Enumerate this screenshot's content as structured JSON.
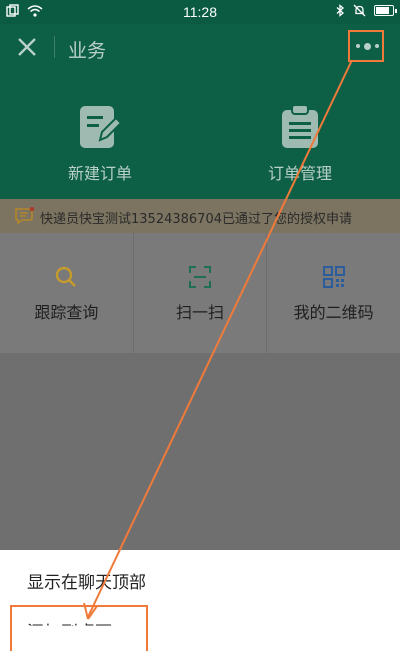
{
  "status_bar": {
    "time": "11:28",
    "battery_level": 0.85
  },
  "header": {
    "title": "业务"
  },
  "quick_actions": [
    {
      "label": "新建订单",
      "icon": "edit-document-icon"
    },
    {
      "label": "订单管理",
      "icon": "clipboard-icon"
    }
  ],
  "notice": {
    "text": "快递员快宝测试13524386704已通过了您的授权申请"
  },
  "grid": [
    {
      "label": "跟踪查询",
      "icon": "search-icon"
    },
    {
      "label": "扫一扫",
      "icon": "scan-icon"
    },
    {
      "label": "我的二维码",
      "icon": "qr-code-icon"
    }
  ],
  "sheet": {
    "items": [
      {
        "label": "显示在聊天顶部"
      },
      {
        "label": "添加到桌面"
      }
    ]
  },
  "colors": {
    "header": "#0d5f46",
    "annotation": "#f07a3a",
    "search_icon": "#c69b2c",
    "scan_icon": "#1f6f56",
    "qr_icon": "#2b5c9b"
  }
}
